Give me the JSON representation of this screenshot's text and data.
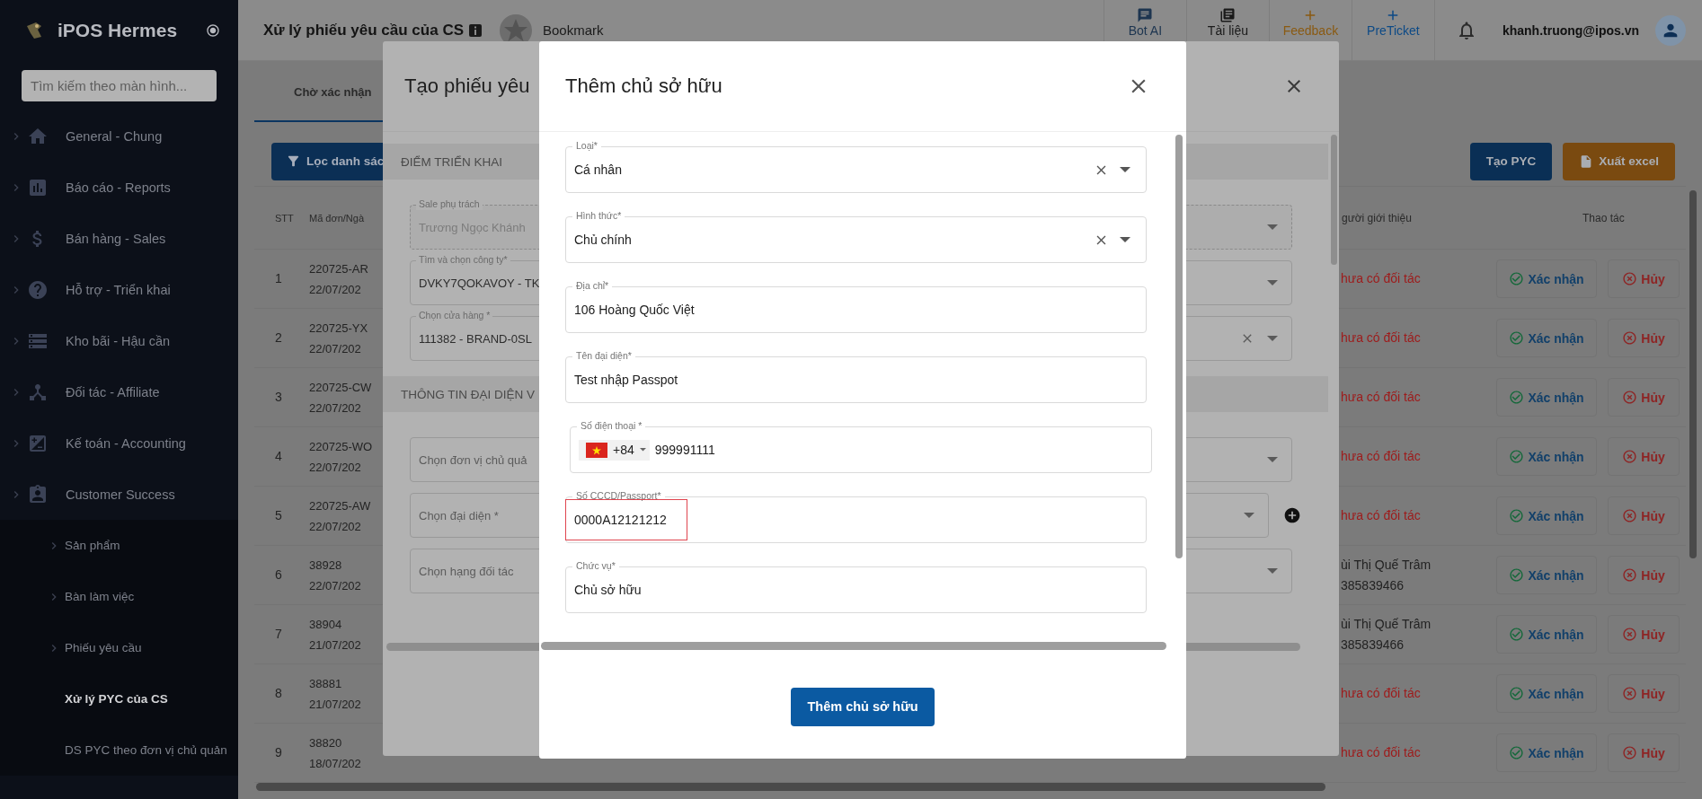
{
  "sidebar": {
    "brand": "iPOS Hermes",
    "search": {
      "placeholder": "Tìm kiếm theo màn hình..."
    },
    "items": [
      {
        "label": "General - Chung"
      },
      {
        "label": "Báo cáo - Reports"
      },
      {
        "label": "Bán hàng - Sales"
      },
      {
        "label": "Hỗ trợ - Triển khai"
      },
      {
        "label": "Kho bãi - Hậu cần"
      },
      {
        "label": "Đối tác - Affiliate"
      },
      {
        "label": "Kế toán - Accounting"
      },
      {
        "label": "Customer Success",
        "children": [
          {
            "label": "Sản phẩm",
            "expandable": true,
            "selected": false
          },
          {
            "label": "Bàn làm việc",
            "expandable": true,
            "selected": false
          },
          {
            "label": "Phiếu yêu cầu",
            "expandable": true,
            "selected": false
          },
          {
            "label": "Xử lý PYC của CS",
            "expandable": false,
            "selected": true
          },
          {
            "label": "DS PYC theo đơn vị chủ quản",
            "expandable": false,
            "selected": false
          }
        ]
      }
    ]
  },
  "header": {
    "title": "Xử lý phiếu yêu cầu của CS",
    "bookmark": "Bookmark",
    "nav": [
      {
        "label": "Bot AI",
        "color": "#1d3550"
      },
      {
        "label": "Tài liệu",
        "color": "#1a1a1a"
      },
      {
        "label": "Feedback",
        "color": "#8a5a12"
      },
      {
        "label": "PreTicket",
        "color": "#0d4a86"
      }
    ],
    "user": "khanh.truong@ipos.vn"
  },
  "tabs": [
    {
      "label": "Chờ xác nhận",
      "selected": true
    }
  ],
  "toolbar": {
    "filter_button": "Lọc danh sác",
    "create_button": "Tạo PYC",
    "export_button": "Xuất excel"
  },
  "table": {
    "columns": [
      "STT",
      "Mã đơn/Ngà",
      "gười giới thiệu",
      "Thao tác"
    ],
    "rows": [
      {
        "stt": "1",
        "code": "220725-AR",
        "date": "22/07/202",
        "referrer": {
          "kind": "missing",
          "text": "hưa có đối tác"
        },
        "confirm": "Xác nhận",
        "cancel": "Hủy"
      },
      {
        "stt": "2",
        "code": "220725-YX",
        "date": "22/07/202",
        "referrer": {
          "kind": "missing",
          "text": "hưa có đối tác"
        },
        "confirm": "Xác nhận",
        "cancel": "Hủy"
      },
      {
        "stt": "3",
        "code": "220725-CW",
        "date": "22/07/202",
        "referrer": {
          "kind": "missing",
          "text": "hưa có đối tác"
        },
        "confirm": "Xác nhận",
        "cancel": "Hủy"
      },
      {
        "stt": "4",
        "code": "220725-WO",
        "date": "22/07/202",
        "referrer": {
          "kind": "missing",
          "text": "hưa có đối tác"
        },
        "confirm": "Xác nhận",
        "cancel": "Hủy"
      },
      {
        "stt": "5",
        "code": "220725-AW",
        "date": "22/07/202",
        "referrer": {
          "kind": "missing",
          "text": "hưa có đối tác"
        },
        "confirm": "Xác nhận",
        "cancel": "Hủy"
      },
      {
        "stt": "6",
        "code": "38928",
        "date": "22/07/202",
        "referrer": {
          "kind": "person",
          "text": "ùi Thị Quế Trâm",
          "phone": "385839466"
        },
        "confirm": "Xác nhận",
        "cancel": "Hủy"
      },
      {
        "stt": "7",
        "code": "38904",
        "date": "21/07/202",
        "referrer": {
          "kind": "person",
          "text": "ùi Thị Quế Trâm",
          "phone": "385839466"
        },
        "confirm": "Xác nhận",
        "cancel": "Hủy"
      },
      {
        "stt": "8",
        "code": "38881",
        "date": "21/07/202",
        "referrer": {
          "kind": "missing",
          "text": "hưa có đối tác"
        },
        "confirm": "Xác nhận",
        "cancel": "Hủy"
      },
      {
        "stt": "9",
        "code": "38820",
        "date": "18/07/202",
        "referrer": {
          "kind": "missing",
          "text": "hưa có đối tác"
        },
        "confirm": "Xác nhận",
        "cancel": "Hủy"
      }
    ]
  },
  "back_modal": {
    "title": "Tạo phiếu yêu",
    "sections": [
      {
        "title": "ĐIỂM TRIỂN KHAI",
        "fields": [
          {
            "label": "Sale phụ trách",
            "value": "Trương Ngọc Khánh",
            "disabled": true,
            "clearable": false,
            "addable": false
          },
          {
            "label": "Tìm và chọn công ty*",
            "value": "DVKY7QOKAVOY - TK",
            "disabled": false,
            "clearable": false,
            "addable": false
          },
          {
            "label": "Chọn cửa hàng *",
            "value": "111382 - BRAND-0SL",
            "disabled": false,
            "clearable": true,
            "addable": false
          }
        ]
      },
      {
        "title": "THÔNG TIN ĐẠI DIỆN V",
        "fields": [
          {
            "placeholder": "Chọn đơn vị chủ quả",
            "disabled": false,
            "clearable": false,
            "addable": false
          },
          {
            "placeholder": "Chọn đại diện *",
            "disabled": false,
            "clearable": false,
            "addable": true
          },
          {
            "placeholder": "Chọn hạng đối tác",
            "disabled": false,
            "clearable": false,
            "addable": false
          }
        ]
      }
    ]
  },
  "modal": {
    "title": "Thêm chủ sở hữu",
    "fields": [
      {
        "kind": "select",
        "label": "Loại*",
        "value": "Cá nhân",
        "clearable": true,
        "highlighted": false
      },
      {
        "kind": "select",
        "label": "Hình thức*",
        "value": "Chủ chính",
        "clearable": true,
        "highlighted": false
      },
      {
        "kind": "text",
        "label": "Địa chỉ*",
        "value": "106 Hoàng Quốc Việt",
        "clearable": false,
        "highlighted": false
      },
      {
        "kind": "text",
        "label": "Tên đại diện*",
        "value": "Test nhập Passpot",
        "clearable": false,
        "highlighted": false
      },
      {
        "kind": "phone",
        "label": "Số điện thoại *",
        "dial_code": "+84",
        "value": "999991111",
        "clearable": false,
        "highlighted": false
      },
      {
        "kind": "text",
        "label": "Số CCCD/Passport*",
        "value": "0000A12121212",
        "clearable": false,
        "highlighted": true
      },
      {
        "kind": "text",
        "label": "Chức vụ*",
        "value": "Chủ sở hữu",
        "clearable": false,
        "highlighted": false
      }
    ],
    "submit": "Thêm chủ sở hữu"
  }
}
